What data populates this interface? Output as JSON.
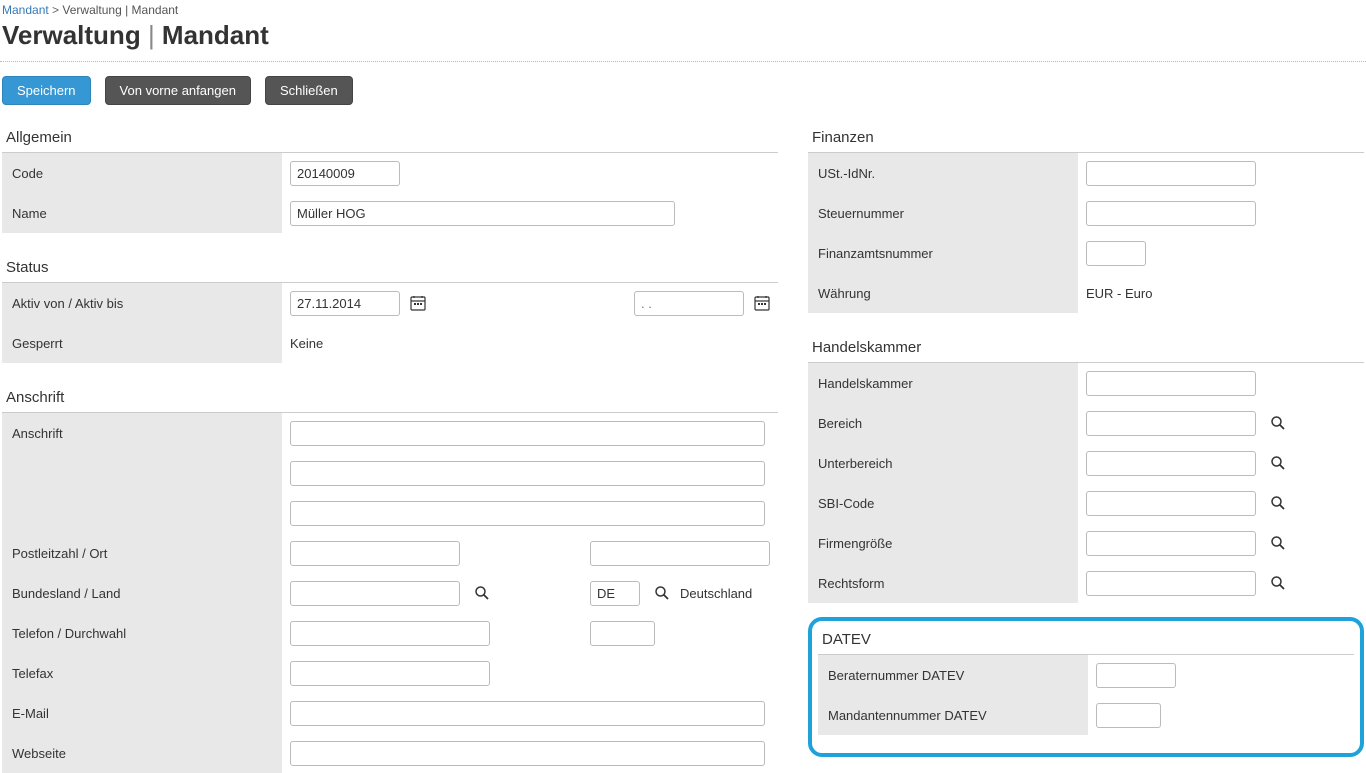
{
  "breadcrumb": {
    "root": "Mandant",
    "current": "Verwaltung | Mandant"
  },
  "title": {
    "part1": "Verwaltung",
    "part2": "Mandant"
  },
  "buttons": {
    "save": "Speichern",
    "restart": "Von vorne anfangen",
    "close": "Schließen"
  },
  "sections": {
    "allgemein": "Allgemein",
    "status": "Status",
    "anschrift": "Anschrift",
    "finanzen": "Finanzen",
    "handelskammer": "Handelskammer",
    "datev": "DATEV"
  },
  "labels": {
    "code": "Code",
    "name": "Name",
    "aktiv": "Aktiv von / Aktiv bis",
    "gesperrt": "Gesperrt",
    "anschrift": "Anschrift",
    "plzort": "Postleitzahl / Ort",
    "bundesland": "Bundesland / Land",
    "telefon": "Telefon / Durchwahl",
    "telefax": "Telefax",
    "email": "E-Mail",
    "webseite": "Webseite",
    "ustid": "USt.-IdNr.",
    "steuernummer": "Steuernummer",
    "finanzamt": "Finanzamtsnummer",
    "waehrung": "Währung",
    "handelskammer": "Handelskammer",
    "bereich": "Bereich",
    "unterbereich": "Unterbereich",
    "sbi": "SBI-Code",
    "firmengroesse": "Firmengröße",
    "rechtsform": "Rechtsform",
    "berater": "Beraternummer DATEV",
    "mandantennr": "Mandantennummer DATEV"
  },
  "values": {
    "code": "20140009",
    "name": "Müller HOG",
    "aktiv_von": "27.11.2014",
    "aktiv_bis_placeholder": ". .",
    "gesperrt": "Keine",
    "land_code": "DE",
    "land_name": "Deutschland",
    "waehrung": "EUR - Euro"
  }
}
